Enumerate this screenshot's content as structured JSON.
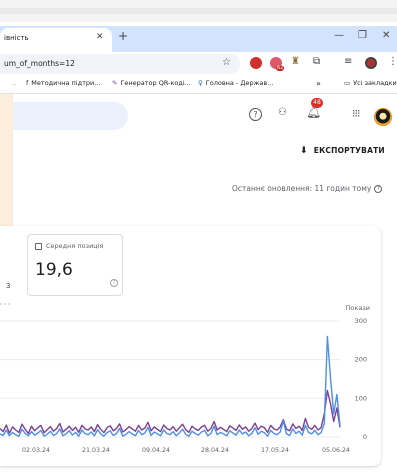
{
  "browser": {
    "tab_title": "івність",
    "tab_close": "✕",
    "new_tab": "+",
    "minimize": "—",
    "restore": "❐",
    "close": "✕",
    "url": "um_of_months=12",
    "star": "☆",
    "ext_badge": "62",
    "bookmarks": [
      {
        "icon": "f",
        "label": "Методична підтри..."
      },
      {
        "icon": "✎",
        "label": "Генератор QR-коді..."
      },
      {
        "icon": "♀",
        "label": "Головна - Держав..."
      }
    ],
    "bookmarks_more": "»",
    "all_bookmarks": "Усі закладки"
  },
  "app": {
    "help": "?",
    "bell_badge": "48",
    "export_icon": "⬇",
    "export_label": "ЕКСПОРТУВАТИ",
    "updated": "Останнє оновлення: 11 годин тому",
    "updated_icon": "?"
  },
  "metric": {
    "left_value": "3",
    "label": "Середня позиція",
    "value": "19,6",
    "help": "?"
  },
  "chart_data": {
    "type": "line",
    "y_axis_title": "Покази",
    "y_ticks": [
      0,
      100,
      200,
      300
    ],
    "ylim": [
      0,
      300
    ],
    "x_labels": [
      "02.03.24",
      "21.03.24",
      "09.04.24",
      "28.04.24",
      "17.05.24",
      "05.06.24"
    ],
    "series": [
      {
        "color": "#7b3f98",
        "values": [
          22,
          14,
          31,
          10,
          26,
          18,
          12,
          33,
          20,
          9,
          28,
          16,
          24,
          30,
          11,
          19,
          27,
          15,
          22,
          35,
          13,
          20,
          28,
          17,
          25,
          12,
          30,
          21,
          18,
          26,
          14,
          32,
          20,
          11,
          24,
          29,
          16,
          22,
          34,
          13,
          19,
          27,
          21,
          15,
          30,
          18,
          23,
          38,
          16,
          26,
          20,
          14,
          31,
          22,
          18,
          27,
          15,
          24,
          33,
          19,
          12,
          28,
          21,
          17,
          26,
          30,
          15,
          22,
          40,
          18,
          25,
          20,
          14,
          29,
          23,
          17,
          31,
          20,
          26,
          15,
          22,
          36,
          19,
          28,
          24,
          12,
          30,
          21,
          18,
          26,
          45,
          20,
          16,
          34,
          22,
          28,
          17,
          48,
          25,
          20,
          30,
          18,
          24,
          60,
          120,
          85,
          40,
          75,
          25
        ]
      },
      {
        "color": "#4e8fe8",
        "values": [
          8,
          4,
          18,
          3,
          12,
          6,
          2,
          20,
          9,
          3,
          14,
          5,
          10,
          17,
          2,
          7,
          15,
          4,
          9,
          21,
          3,
          8,
          16,
          5,
          12,
          2,
          18,
          9,
          6,
          13,
          3,
          19,
          8,
          2,
          11,
          16,
          4,
          9,
          22,
          2,
          7,
          14,
          8,
          3,
          17,
          6,
          10,
          25,
          4,
          13,
          8,
          3,
          18,
          9,
          6,
          14,
          3,
          11,
          20,
          7,
          2,
          15,
          9,
          5,
          13,
          17,
          3,
          9,
          28,
          6,
          12,
          8,
          3,
          16,
          10,
          5,
          18,
          8,
          13,
          3,
          9,
          24,
          7,
          15,
          11,
          2,
          17,
          9,
          6,
          13,
          42,
          8,
          4,
          21,
          9,
          15,
          5,
          30,
          12,
          8,
          17,
          6,
          11,
          35,
          260,
          150,
          60,
          110,
          30
        ]
      }
    ]
  }
}
